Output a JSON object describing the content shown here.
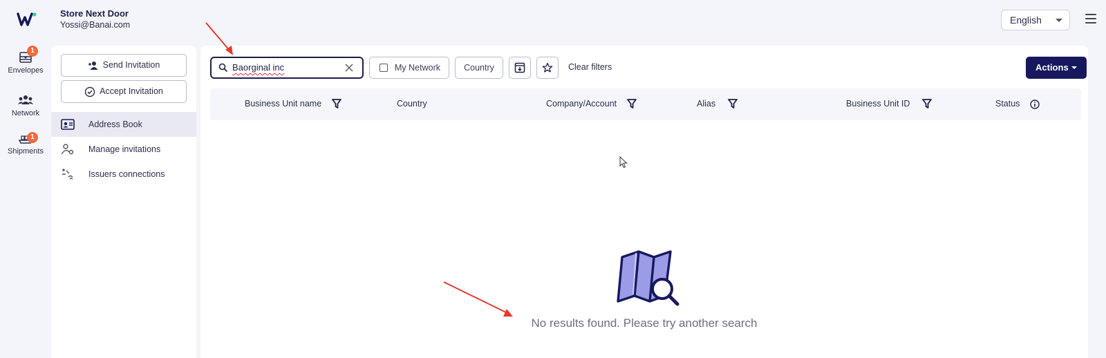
{
  "header": {
    "logo": "W",
    "account_name": "Store Next Door",
    "account_email": "Yossi@Banai.com",
    "language": "English"
  },
  "rail": [
    {
      "label": "Envelopes",
      "badge": "1",
      "icon": "envelopes-icon"
    },
    {
      "label": "Network",
      "badge": "",
      "icon": "network-icon"
    },
    {
      "label": "Shipments",
      "badge": "1",
      "icon": "shipments-icon"
    }
  ],
  "sidebar": {
    "send_invitation": "Send Invitation",
    "accept_invitation": "Accept Invitation",
    "items": [
      {
        "label": "Address Book",
        "active": true
      },
      {
        "label": "Manage invitations",
        "active": false
      },
      {
        "label": "Issuers connections",
        "active": false
      }
    ]
  },
  "toolbar": {
    "search_value": "Baorginal inc",
    "my_network": "My Network",
    "country": "Country",
    "clear_filters": "Clear filters",
    "actions": "Actions"
  },
  "table": {
    "columns": [
      {
        "label": "Business Unit name",
        "filter": true
      },
      {
        "label": "Country",
        "filter": false
      },
      {
        "label": "Company/Account",
        "filter": true
      },
      {
        "label": "Alias",
        "filter": true
      },
      {
        "label": "Business Unit ID",
        "filter": true
      },
      {
        "label": "Status",
        "info": true
      }
    ]
  },
  "empty_state": {
    "message": "No results found. Please try another search",
    "icon": "map-search-icon"
  },
  "colors": {
    "brand": "#17195e",
    "badge": "#f26b3a",
    "accent_green": "#2bd39a",
    "annotation": "#e8382e"
  }
}
